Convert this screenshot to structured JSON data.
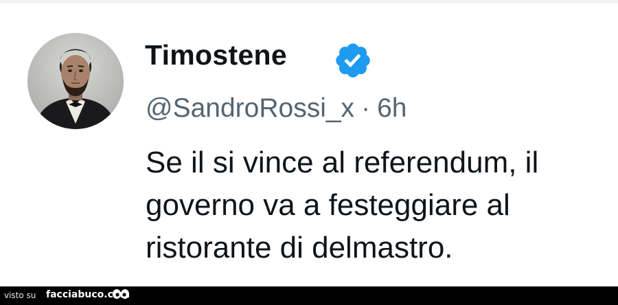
{
  "tweet": {
    "author": {
      "display_name": "Timostene",
      "handle": "@SandroRossi_x",
      "verified": true,
      "avatar_icon": "avatar-portrait"
    },
    "separator": "·",
    "timestamp": "6h",
    "text_lines": [
      "Se il si vince al referendum, il",
      "governo va a festeggiare al",
      "ristorante di delmastro."
    ]
  },
  "watermark": {
    "prefix": "visto su",
    "site": "facciabuco.com",
    "logo_icon": "eyes-icon"
  },
  "colors": {
    "verified_blue": "#1d9bf0",
    "text_primary": "#0f1419",
    "text_secondary": "#536471",
    "watermark_bg": "#000000"
  }
}
